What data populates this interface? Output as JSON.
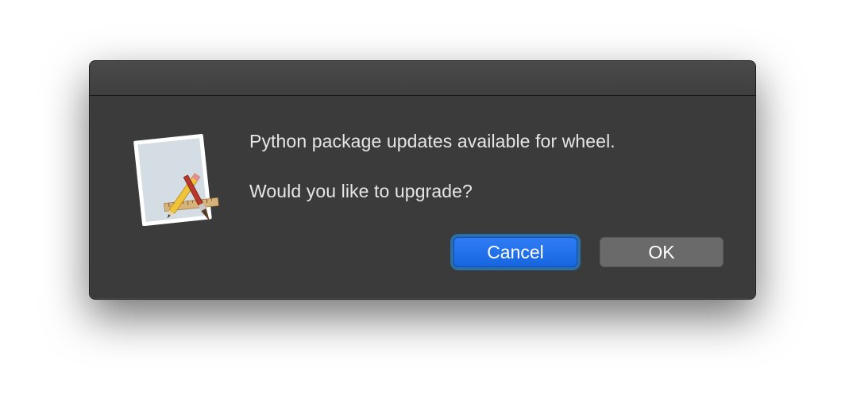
{
  "dialog": {
    "message": "Python package updates available for wheel.",
    "question": "Would you like to upgrade?",
    "buttons": {
      "cancel_label": "Cancel",
      "ok_label": "OK"
    },
    "icon": "script-editor-app-icon",
    "colors": {
      "background": "#3b3b3b",
      "default_button": "#1f6fe8",
      "secondary_button": "#6a6a6a",
      "text": "#e6e6e6"
    }
  }
}
